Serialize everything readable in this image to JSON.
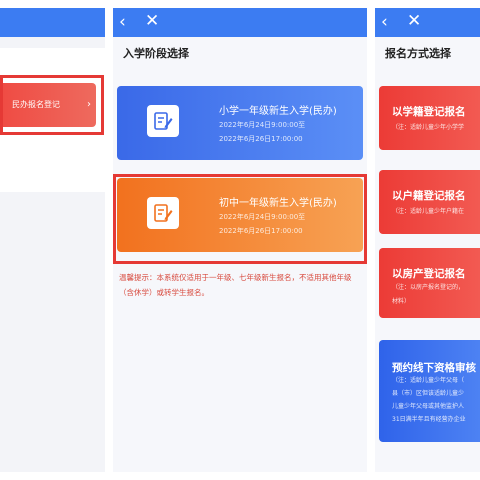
{
  "nav": {
    "back_icon": "‹",
    "close_icon": "✕"
  },
  "left_panel": {
    "entry_label": "民办报名登记",
    "entry_arrow": "›"
  },
  "stage_screen": {
    "title": "入学阶段选择",
    "cards": [
      {
        "title": "小学一年级新生入学(民办)",
        "start": "2022年6月24日9:00:00至",
        "end": "2022年6月26日17:00:00",
        "icon": "pen-document-icon"
      },
      {
        "title": "初中一年级新生入学(民办)",
        "start": "2022年6月24日9:00:00至",
        "end": "2022年6月26日17:00:00",
        "icon": "pen-document-icon"
      }
    ],
    "notice": "温馨提示：本系统仅适用于一年级、七年级新生报名，不适用其他年级（含休学）或转学生报名。"
  },
  "mode_screen": {
    "title": "报名方式选择",
    "options": [
      {
        "title": "以学籍登记报名",
        "note1": "（注：适龄儿童少年小学学",
        "note2": ""
      },
      {
        "title": "以户籍登记报名",
        "note1": "（注：适龄儿童少年户籍在",
        "note2": ""
      },
      {
        "title": "以房产登记报名",
        "note1": "（注：以房产报名登记的，",
        "note2": "材料）"
      },
      {
        "title": "预约线下资格审核",
        "note1": "（注：适龄儿童少年父母（",
        "note2": "县（市）区但该适龄儿童少",
        "note3": "儿童少年父母或其他监护人",
        "note4": "31日满半年且有经营办企业"
      }
    ]
  },
  "colors": {
    "topbar": "#3c7cf2",
    "highlight": "#e53935",
    "primary_card": "#3a69e8",
    "junior_card": "#f2711e",
    "mode_red": "#ec3b36",
    "mode_blue": "#2f63ea",
    "notice_text": "#d84a3e"
  }
}
